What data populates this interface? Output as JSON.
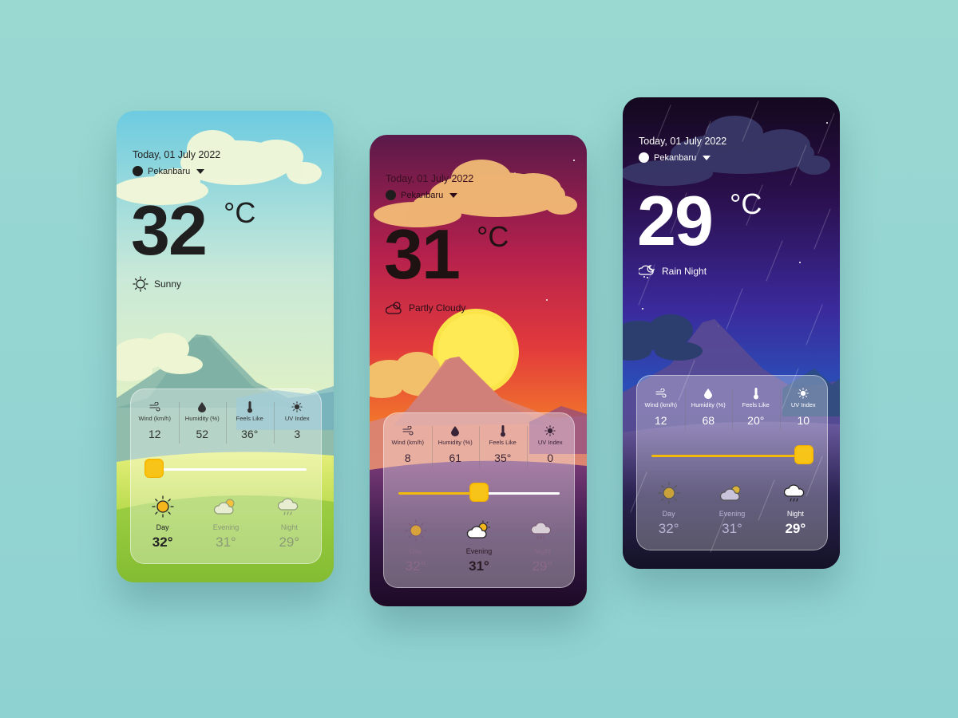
{
  "colors": {
    "accent": "#f0b90b",
    "background": "#95d3d0"
  },
  "cards": [
    {
      "date": "Today, 01 July 2022",
      "location": "Pekanbaru",
      "temp": "32",
      "unit": "°C",
      "condition": "Sunny",
      "stats": [
        {
          "label": "Wind (km/h)",
          "value": "12",
          "icon": "wind-icon"
        },
        {
          "label": "Humidity (%)",
          "value": "52",
          "icon": "humidity-icon"
        },
        {
          "label": "Feels Like",
          "value": "36°",
          "icon": "thermometer-icon"
        },
        {
          "label": "UV Index",
          "value": "3",
          "icon": "uv-icon"
        }
      ],
      "slider_value": 0,
      "times": [
        {
          "label": "Day",
          "value": "32°",
          "icon": "sun-icon"
        },
        {
          "label": "Evening",
          "value": "31°",
          "icon": "partly-cloudy-icon"
        },
        {
          "label": "Night",
          "value": "29°",
          "icon": "rain-cloud-icon"
        }
      ]
    },
    {
      "date": "Today, 01 July 2022",
      "location": "Pekanbaru",
      "temp": "31",
      "unit": "°C",
      "condition": "Partly Cloudy",
      "stats": [
        {
          "label": "Wind (km/h)",
          "value": "8",
          "icon": "wind-icon"
        },
        {
          "label": "Humidity (%)",
          "value": "61",
          "icon": "humidity-icon"
        },
        {
          "label": "Feels Like",
          "value": "35°",
          "icon": "thermometer-icon"
        },
        {
          "label": "UV Index",
          "value": "0",
          "icon": "uv-icon"
        }
      ],
      "slider_value": 0.5,
      "times": [
        {
          "label": "Day",
          "value": "32°",
          "icon": "sun-icon"
        },
        {
          "label": "Evening",
          "value": "31°",
          "icon": "partly-cloudy-icon"
        },
        {
          "label": "Night",
          "value": "29°",
          "icon": "rain-cloud-icon"
        }
      ]
    },
    {
      "date": "Today, 01 July 2022",
      "location": "Pekanbaru",
      "temp": "29",
      "unit": "°C",
      "condition": "Rain Night",
      "stats": [
        {
          "label": "Wind (km/h)",
          "value": "12",
          "icon": "wind-icon"
        },
        {
          "label": "Humidity (%)",
          "value": "68",
          "icon": "humidity-icon"
        },
        {
          "label": "Feels Like",
          "value": "20°",
          "icon": "thermometer-icon"
        },
        {
          "label": "UV Index",
          "value": "10",
          "icon": "uv-icon"
        }
      ],
      "slider_value": 1,
      "times": [
        {
          "label": "Day",
          "value": "32°",
          "icon": "sun-icon"
        },
        {
          "label": "Evening",
          "value": "31°",
          "icon": "partly-cloudy-icon"
        },
        {
          "label": "Night",
          "value": "29°",
          "icon": "rain-cloud-icon"
        }
      ]
    }
  ]
}
